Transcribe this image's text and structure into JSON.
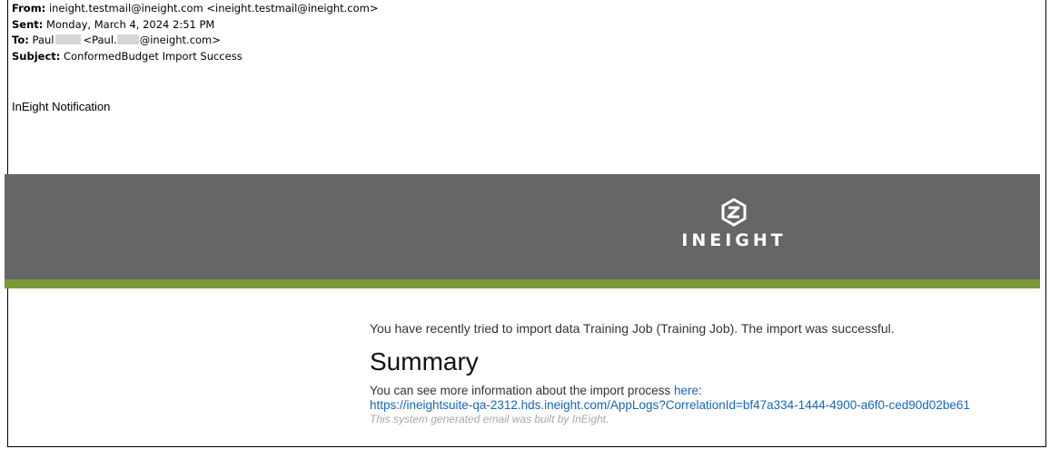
{
  "email": {
    "from_label": "From:",
    "from_value": "ineight.testmail@ineight.com <ineight.testmail@ineight.com>",
    "sent_label": "Sent:",
    "sent_value": "Monday, March 4, 2024 2:51 PM",
    "to_label": "To:",
    "to_name_first": "Paul",
    "to_addr_prefix": "<Paul.",
    "to_addr_suffix": "@ineight.com>",
    "subject_label": "Subject:",
    "subject_value": "ConformedBudget Import Success"
  },
  "intro": "InEight Notification",
  "banner": {
    "wordmark": "INEIGHT",
    "bg_color": "#666666",
    "stripe_color": "#7c9a3a"
  },
  "body": {
    "message": "You have recently tried to import data Training Job (Training Job). The import was successful.",
    "summary_heading": "Summary",
    "more_info": "You can see more information about the import process ",
    "here_link": "here",
    "colon": ":",
    "url": "https://ineightsuite-qa-2312.hds.ineight.com/AppLogs?CorrelationId=bf47a334-1444-4900-a6f0-ced90d02be61",
    "footer": "This system generated email was built by InEight."
  }
}
